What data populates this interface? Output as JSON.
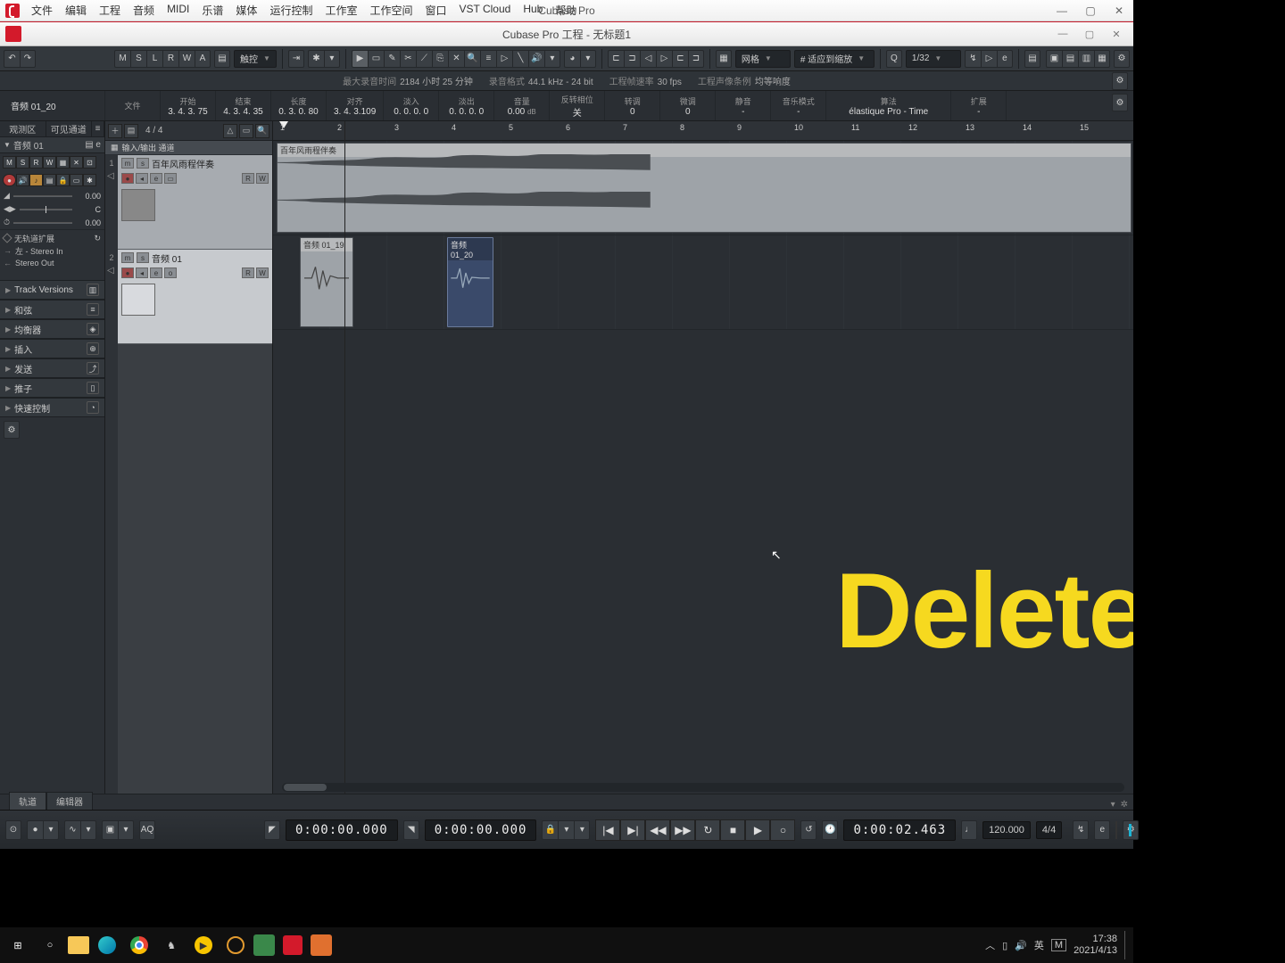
{
  "app": {
    "title": "Cubase Pro"
  },
  "project": {
    "title": "Cubase Pro 工程 - 无标题1"
  },
  "menu": [
    "文件",
    "编辑",
    "工程",
    "音频",
    "MIDI",
    "乐谱",
    "媒体",
    "运行控制",
    "工作室",
    "工作空间",
    "窗口",
    "VST Cloud",
    "Hub",
    "帮助"
  ],
  "toolbar": {
    "state_letters": [
      "M",
      "S",
      "L",
      "R",
      "W",
      "A"
    ],
    "automation_mode": "触控",
    "snap_label": "网格",
    "quantize_label": "# 适应到缩放",
    "q_value": "1/32",
    "q_prefix": "Q"
  },
  "status": {
    "max_rec_label": "最大录音时间",
    "max_rec_value": "2184 小时 25 分钟",
    "format_label": "录音格式",
    "format_value": "44.1 kHz - 24 bit",
    "fps_label": "工程帧速率",
    "fps_value": "30 fps",
    "pan_label": "工程声像条例",
    "pan_value": "均等响度"
  },
  "info": {
    "file_label": "文件",
    "file_value": "",
    "start_label": "开始",
    "start_value": "3. 4. 3. 75",
    "end_label": "结束",
    "end_value": "4. 3. 4. 35",
    "length_label": "长度",
    "length_value": "0. 3. 0. 80",
    "align_label": "对齐",
    "align_value": "3. 4. 3.109",
    "fadein_label": "淡入",
    "fadein_value": "0. 0. 0. 0",
    "fadeout_label": "淡出",
    "fadeout_value": "0. 0. 0. 0",
    "vol_label": "音量",
    "vol_value": "0.00",
    "vol_unit": "dB",
    "lock_label": "反转相位",
    "lock_value": "关",
    "transpose_label": "转调",
    "transpose_value": "0",
    "fine_label": "微调",
    "fine_value": "0",
    "mute_label": "静音",
    "mute_value": "-",
    "musmode_label": "音乐模式",
    "musmode_value": "-",
    "algo_label": "算法",
    "algo_value": "élastique Pro - Time",
    "ext_label": "扩展",
    "ext_value": "-"
  },
  "inspector": {
    "tabs": [
      "观测区",
      "可见通道"
    ],
    "track_name": "音频 01",
    "left_in": "左 - Stereo In",
    "out": "Stereo Out",
    "no_ext": "无轨道扩展",
    "val1": "0.00",
    "pan": "C",
    "val2": "0.00",
    "sections": [
      "Track Versions",
      "和弦",
      "均衡器",
      "插入",
      "发送",
      "推子",
      "快速控制"
    ]
  },
  "tracklist": {
    "time_sig": "4 / 4",
    "io_header": "输入/输出 通道",
    "tracks": [
      {
        "name": "百年风雨程伴奏"
      },
      {
        "name": "音频 01"
      }
    ]
  },
  "ruler_marks": [
    1,
    2,
    3,
    4,
    5,
    6,
    7,
    8,
    9,
    10,
    11,
    12,
    13,
    14,
    15
  ],
  "clips": {
    "big": "百年风雨程伴奏",
    "small1": "音频 01_19",
    "small2": "音频 01_20"
  },
  "selected_event": "音频 01_20",
  "overlay": "Delete",
  "bottom_tabs": [
    "轨道",
    "编辑器"
  ],
  "transport": {
    "left_tc": "0:00:00.000",
    "right_tc": "0:00:00.000",
    "pos": "0:00:02.463",
    "tempo": "120.000",
    "sig": "4/4",
    "aq": "AQ"
  },
  "system": {
    "time": "17:38",
    "date": "2021/4/13",
    "ime": "英",
    "ms": "M"
  }
}
